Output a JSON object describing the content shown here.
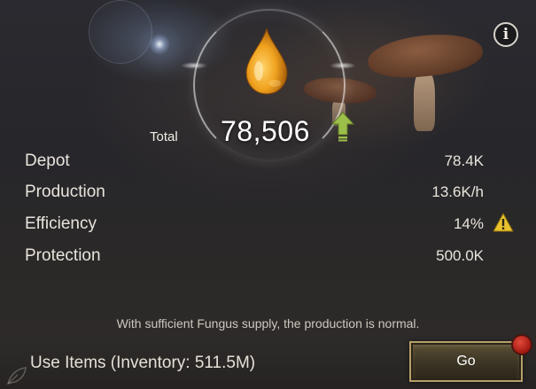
{
  "resource": {
    "icon": "oil-drop-icon",
    "total_label": "Total",
    "total_value": "78,506",
    "trend_icon": "up-arrow-icon"
  },
  "stats": [
    {
      "label": "Depot",
      "value": "78.4K"
    },
    {
      "label": "Production",
      "value": "13.6K/h"
    },
    {
      "label": "Efficiency",
      "value": "14%",
      "warning": true
    },
    {
      "label": "Protection",
      "value": "500.0K"
    }
  ],
  "notice": "With sufficient Fungus supply, the production is normal.",
  "footer": {
    "use_items_label": "Use Items (Inventory: 511.5M)",
    "go_label": "Go",
    "go_has_notification": true
  },
  "colors": {
    "warning": "#e9c22e",
    "arrow": "#9cbf4a",
    "notification": "#c0251a",
    "button_border": "#b6a06a"
  }
}
